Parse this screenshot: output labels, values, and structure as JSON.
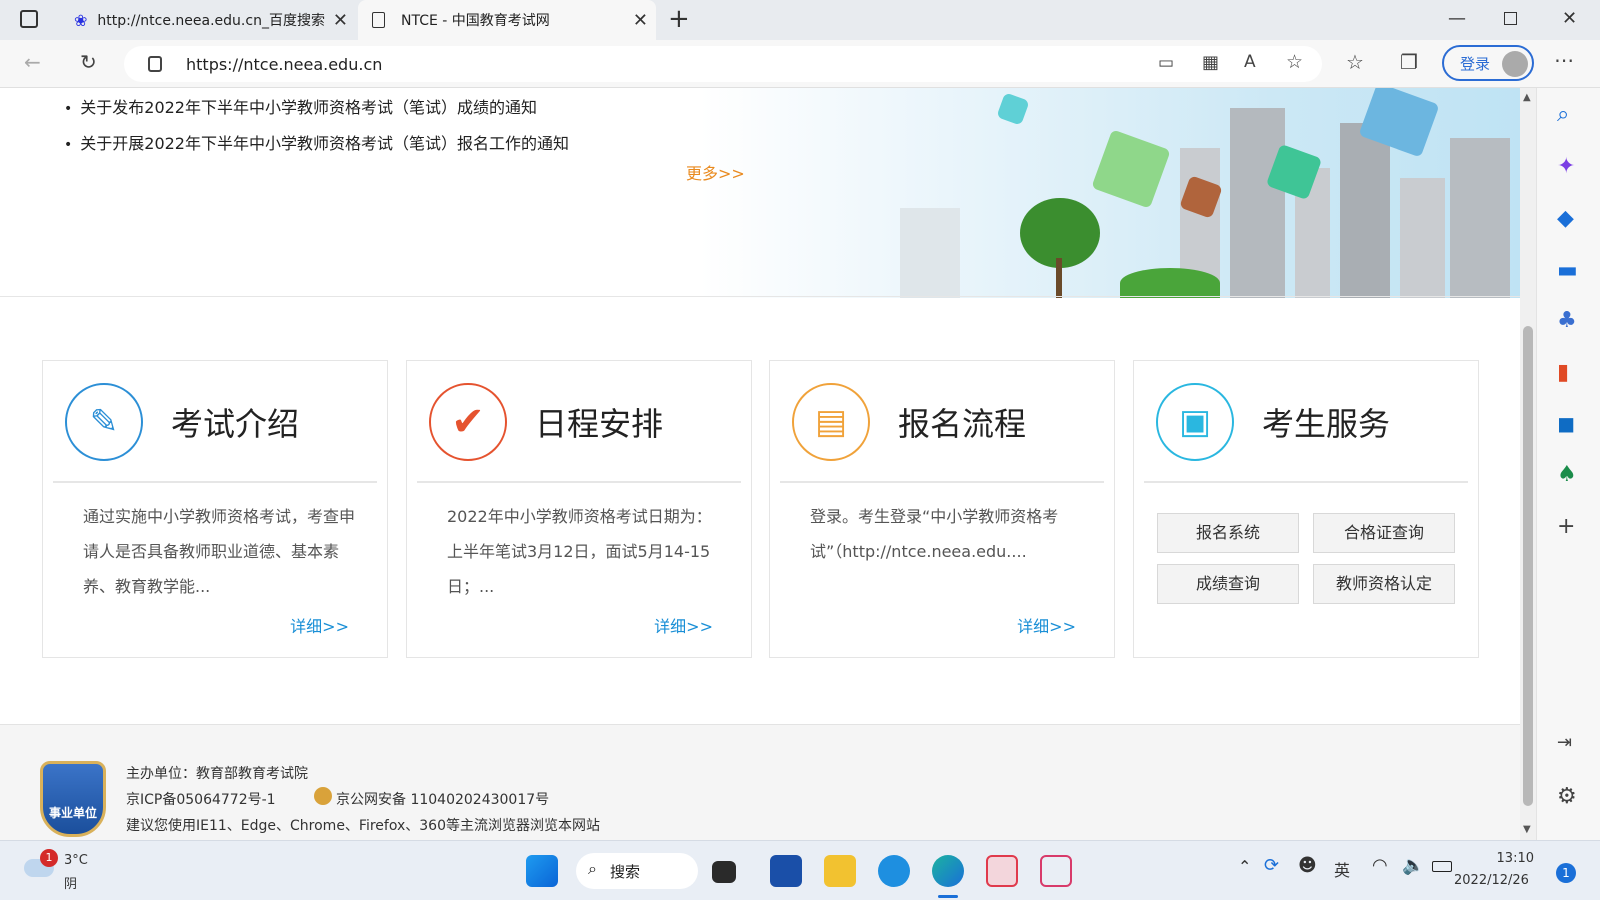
{
  "tabs": [
    {
      "title": "http://ntce.neea.edu.cn_百度搜索",
      "icon": "baidu-paw-icon"
    },
    {
      "title": "NTCE - 中国教育考试网",
      "icon": "page-icon"
    }
  ],
  "address_bar": {
    "url": "https://ntce.neea.edu.cn"
  },
  "profile": {
    "login_label": "登录"
  },
  "notices": {
    "items": [
      "关于发布2022年下半年中小学教师资格考试（笔试）成绩的通知",
      "关于开展2022年下半年中小学教师资格考试（笔试）报名工作的通知"
    ],
    "more": "更多>>"
  },
  "cards": [
    {
      "title": "考试介绍",
      "desc": "通过实施中小学教师资格考试，考查申请人是否具备教师职业道德、基本素养、教育教学能...",
      "detail": "详细>>",
      "color": "#2c8fd6",
      "icon": "document-edit-icon"
    },
    {
      "title": "日程安排",
      "desc": "2022年中小学教师资格考试日期为：上半年笔试3月12日，面试5月14-15日；...",
      "detail": "详细>>",
      "color": "#e5532f",
      "icon": "checkmark-icon"
    },
    {
      "title": "报名流程",
      "desc": "登录。考生登录“中小学教师资格考试”（http://ntce.neea.edu....",
      "detail": "详细>>",
      "color": "#f0a23a",
      "icon": "form-icon"
    },
    {
      "title": "考生服务",
      "color": "#2ab7e0",
      "icon": "contacts-icon",
      "buttons": [
        "报名系统",
        "合格证查询",
        "成绩查询",
        "教师资格认定"
      ]
    }
  ],
  "footer": {
    "badge_text": "事业单位",
    "sponsor": "主办单位：教育部教育考试院",
    "icp": "京ICP备05064772号-1",
    "police": "京公网安备 11040202430017号",
    "browser_note": "建议您使用IE11、Edge、Chrome、Firefox、360等主流浏览器浏览本网站"
  },
  "taskbar": {
    "weather_temp": "3°C",
    "weather_desc": "阴",
    "weather_badge": "1",
    "search_label": "搜索",
    "ime": "英",
    "time": "13:10",
    "date": "2022/12/26",
    "notification_count": "1"
  }
}
